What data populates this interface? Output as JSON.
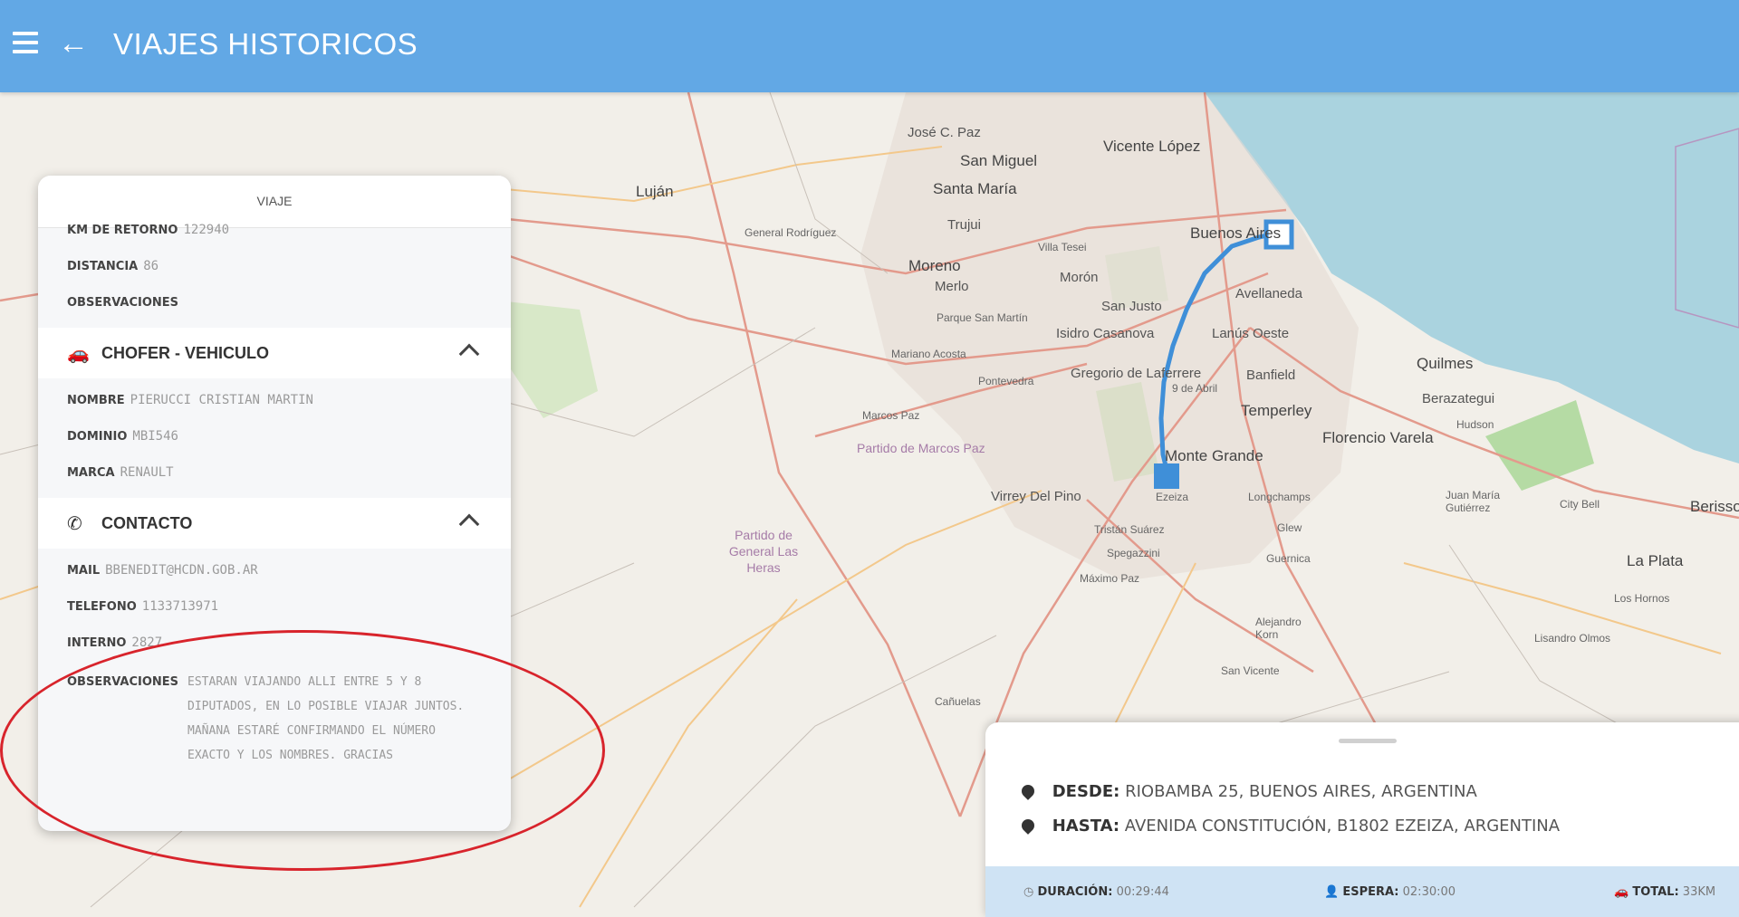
{
  "header": {
    "title": "VIAJES HISTORICOS"
  },
  "card": {
    "title": "VIAJE",
    "viaje_rows": [
      {
        "label": "KM DE RETORNO",
        "value": "122940"
      },
      {
        "label": "DISTANCIA",
        "value": "86"
      },
      {
        "label": "OBSERVACIONES",
        "value": ""
      }
    ],
    "chofer_title": "CHOFER - VEHICULO",
    "chofer_rows": [
      {
        "label": "NOMBRE",
        "value": "PIERUCCI CRISTIAN MARTIN"
      },
      {
        "label": "DOMINIO",
        "value": "MBI546"
      },
      {
        "label": "MARCA",
        "value": "RENAULT"
      }
    ],
    "contacto_title": "CONTACTO",
    "contacto_rows": [
      {
        "label": "MAIL",
        "value": "BBENEDIT@HCDN.GOB.AR"
      },
      {
        "label": "TELEFONO",
        "value": "1133713971"
      },
      {
        "label": "INTERNO",
        "value": "2827"
      }
    ],
    "obs_label": "OBSERVACIONES",
    "obs_value": "ESTARAN VIAJANDO ALLI ENTRE 5 Y 8 DIPUTADOS, EN LO POSIBLE VIAJAR JUNTOS. MAÑANA ESTARÉ CONFIRMANDO EL NÚMERO EXACTO Y LOS NOMBRES. GRACIAS"
  },
  "route": {
    "desde_label": "DESDE:",
    "desde_value": "RIOBAMBA 25, BUENOS AIRES, ARGENTINA",
    "hasta_label": "HASTA:",
    "hasta_value": "AVENIDA CONSTITUCIÓN, B1802 EZEIZA, ARGENTINA",
    "duracion_label": "DURACIÓN:",
    "duracion_value": "00:29:44",
    "espera_label": "ESPERA:",
    "espera_value": "02:30:00",
    "total_label": "TOTAL:",
    "total_value": "33KM"
  },
  "map": {
    "places": [
      "José C. Paz",
      "San Miguel",
      "Vicente López",
      "Santa María",
      "Luján",
      "Trujui",
      "General Rodríguez",
      "Buenos Aires",
      "Moreno",
      "Merlo",
      "Morón",
      "San Justo",
      "Avellaneda",
      "Parque San Martín",
      "Isidro Casanova",
      "Lanús Oeste",
      "Mariano Acosta",
      "Quilmes",
      "Gregorio de Laferrere",
      "Pontevedra",
      "Banfield",
      "9 de Abril",
      "Berazategui",
      "Temperley",
      "Marcos Paz",
      "Partido de Marcos Paz",
      "Monte Grande",
      "Florencio Varela",
      "Virrey Del Pino",
      "Partido de General Las Heras",
      "Longchamps",
      "Tristán Suárez",
      "Glew",
      "Spegazzini",
      "Guernica",
      "Máximo Paz",
      "City Bell",
      "La Plata",
      "Cañuelas",
      "Alejandro Korn",
      "Lisandro Olmos",
      "San Vicente",
      "Los Hornos",
      "Berisso",
      "Ezeiza",
      "Villa Tesei",
      "Hudson",
      "Juan María Gutiérrez"
    ]
  },
  "colors": {
    "header": "#62a8e5",
    "route": "#3f8fd8",
    "annotation": "#d8242c"
  }
}
